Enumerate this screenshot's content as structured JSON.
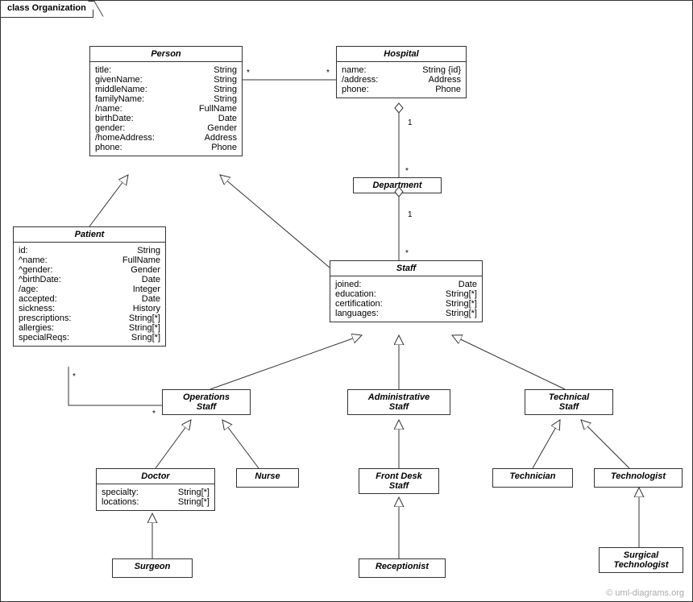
{
  "frame": {
    "title": "class Organization"
  },
  "classes": {
    "person": {
      "name": "Person",
      "attrs": [
        {
          "name": "title:",
          "type": "String"
        },
        {
          "name": "givenName:",
          "type": "String"
        },
        {
          "name": "middleName:",
          "type": "String"
        },
        {
          "name": "familyName:",
          "type": "String"
        },
        {
          "name": "/name:",
          "type": "FullName"
        },
        {
          "name": "birthDate:",
          "type": "Date"
        },
        {
          "name": "gender:",
          "type": "Gender"
        },
        {
          "name": "/homeAddress:",
          "type": "Address"
        },
        {
          "name": "phone:",
          "type": "Phone"
        }
      ]
    },
    "hospital": {
      "name": "Hospital",
      "attrs": [
        {
          "name": "name:",
          "type": "String {id}"
        },
        {
          "name": "/address:",
          "type": "Address"
        },
        {
          "name": "phone:",
          "type": "Phone"
        }
      ]
    },
    "department": {
      "name": "Department",
      "attrs": []
    },
    "patient": {
      "name": "Patient",
      "attrs": [
        {
          "name": "id:",
          "type": "String"
        },
        {
          "name": "^name:",
          "type": "FullName"
        },
        {
          "name": "^gender:",
          "type": "Gender"
        },
        {
          "name": "^birthDate:",
          "type": "Date"
        },
        {
          "name": "/age:",
          "type": "Integer"
        },
        {
          "name": "accepted:",
          "type": "Date"
        },
        {
          "name": "sickness:",
          "type": "History"
        },
        {
          "name": "prescriptions:",
          "type": "String[*]"
        },
        {
          "name": "allergies:",
          "type": "String[*]"
        },
        {
          "name": "specialReqs:",
          "type": "Sring[*]"
        }
      ]
    },
    "staff": {
      "name": "Staff",
      "attrs": [
        {
          "name": "joined:",
          "type": "Date"
        },
        {
          "name": "education:",
          "type": "String[*]"
        },
        {
          "name": "certification:",
          "type": "String[*]"
        },
        {
          "name": "languages:",
          "type": "String[*]"
        }
      ]
    },
    "opstaff": {
      "name": "Operations\nStaff",
      "attrs": []
    },
    "admstaff": {
      "name": "Administrative\nStaff",
      "attrs": []
    },
    "techstaff": {
      "name": "Technical\nStaff",
      "attrs": []
    },
    "doctor": {
      "name": "Doctor",
      "attrs": [
        {
          "name": "specialty:",
          "type": "String[*]"
        },
        {
          "name": "locations:",
          "type": "String[*]"
        }
      ]
    },
    "nurse": {
      "name": "Nurse",
      "attrs": []
    },
    "frontdesk": {
      "name": "Front Desk\nStaff",
      "attrs": []
    },
    "receptionist": {
      "name": "Receptionist",
      "attrs": []
    },
    "technician": {
      "name": "Technician",
      "attrs": []
    },
    "technologist": {
      "name": "Technologist",
      "attrs": []
    },
    "surgtech": {
      "name": "Surgical\nTechnologist",
      "attrs": []
    },
    "surgeon": {
      "name": "Surgeon",
      "attrs": []
    }
  },
  "multiplicities": {
    "person_hospital_left": "*",
    "person_hospital_right": "*",
    "hospital_dept_top": "1",
    "hospital_dept_bottom": "*",
    "dept_staff_top": "1",
    "dept_staff_bottom": "*",
    "patient_ops_top": "*",
    "patient_ops_bottom": "*"
  },
  "credit": "© uml-diagrams.org"
}
